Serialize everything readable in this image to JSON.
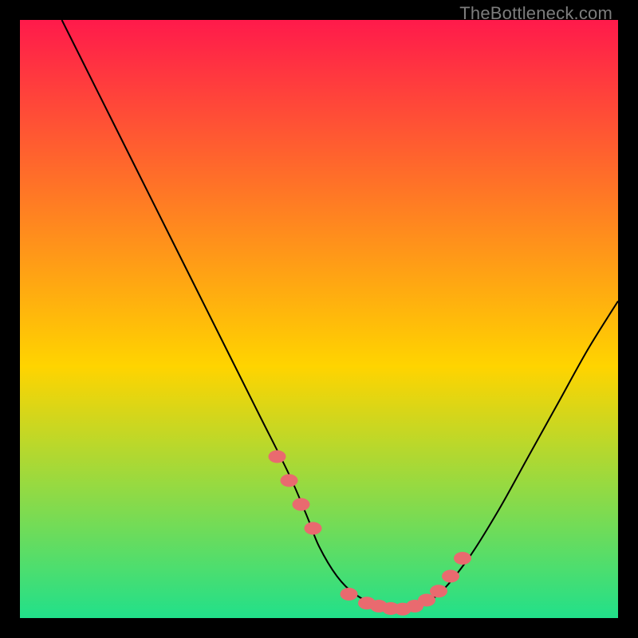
{
  "watermark": "TheBottleneck.com",
  "colors": {
    "background": "#000000",
    "gradient_top": "#ff1a4b",
    "gradient_mid": "#ffd400",
    "gradient_bottom": "#21e08a",
    "curve": "#000000",
    "marker": "#e96a6f",
    "watermark_text": "#7d7d7d"
  },
  "chart_data": {
    "type": "line",
    "title": "",
    "xlabel": "",
    "ylabel": "",
    "xlim": [
      0,
      100
    ],
    "ylim": [
      0,
      100
    ],
    "grid": false,
    "curve": {
      "name": "bottleneck-curve",
      "x": [
        7,
        10,
        15,
        20,
        25,
        30,
        35,
        40,
        45,
        48,
        50,
        53,
        56,
        60,
        63,
        66,
        70,
        75,
        80,
        85,
        90,
        95,
        100
      ],
      "y": [
        100,
        94,
        84,
        74,
        64,
        54,
        44,
        34,
        24,
        17,
        12,
        7,
        4,
        2,
        1.5,
        2,
        4,
        10,
        18,
        27,
        36,
        45,
        53
      ]
    },
    "markers": {
      "name": "highlight-points",
      "x": [
        43,
        45,
        47,
        49,
        55,
        58,
        60,
        62,
        64,
        66,
        68,
        70,
        72,
        74
      ],
      "y": [
        27,
        23,
        19,
        15,
        4,
        2.5,
        2,
        1.6,
        1.5,
        2,
        3,
        4.5,
        7,
        10
      ]
    }
  }
}
